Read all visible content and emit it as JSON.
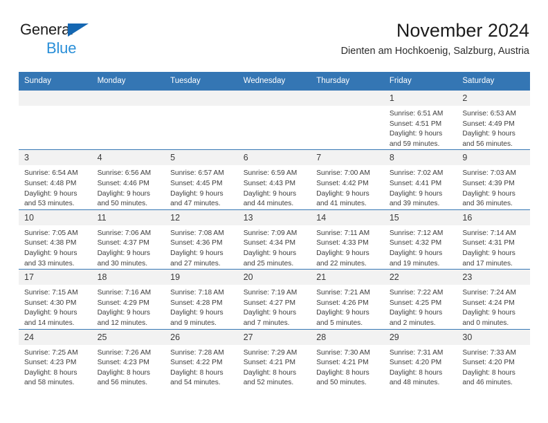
{
  "brand": {
    "name_part1": "General",
    "name_part2": "Blue",
    "triangle_color": "#1567b2",
    "blue_text_color": "#2a8fd8"
  },
  "header": {
    "title": "November 2024",
    "subtitle": "Dienten am Hochkoenig, Salzburg, Austria"
  },
  "theme": {
    "header_blue": "#3476b4",
    "daynum_band": "#f2f2f2",
    "text": "#3c3c3c"
  },
  "calendar": {
    "weekday_headers": [
      "Sunday",
      "Monday",
      "Tuesday",
      "Wednesday",
      "Thursday",
      "Friday",
      "Saturday"
    ],
    "weeks": [
      [
        {
          "day": "",
          "lines": []
        },
        {
          "day": "",
          "lines": []
        },
        {
          "day": "",
          "lines": []
        },
        {
          "day": "",
          "lines": []
        },
        {
          "day": "",
          "lines": []
        },
        {
          "day": "1",
          "lines": [
            "Sunrise: 6:51 AM",
            "Sunset: 4:51 PM",
            "Daylight: 9 hours",
            "and 59 minutes."
          ]
        },
        {
          "day": "2",
          "lines": [
            "Sunrise: 6:53 AM",
            "Sunset: 4:49 PM",
            "Daylight: 9 hours",
            "and 56 minutes."
          ]
        }
      ],
      [
        {
          "day": "3",
          "lines": [
            "Sunrise: 6:54 AM",
            "Sunset: 4:48 PM",
            "Daylight: 9 hours",
            "and 53 minutes."
          ]
        },
        {
          "day": "4",
          "lines": [
            "Sunrise: 6:56 AM",
            "Sunset: 4:46 PM",
            "Daylight: 9 hours",
            "and 50 minutes."
          ]
        },
        {
          "day": "5",
          "lines": [
            "Sunrise: 6:57 AM",
            "Sunset: 4:45 PM",
            "Daylight: 9 hours",
            "and 47 minutes."
          ]
        },
        {
          "day": "6",
          "lines": [
            "Sunrise: 6:59 AM",
            "Sunset: 4:43 PM",
            "Daylight: 9 hours",
            "and 44 minutes."
          ]
        },
        {
          "day": "7",
          "lines": [
            "Sunrise: 7:00 AM",
            "Sunset: 4:42 PM",
            "Daylight: 9 hours",
            "and 41 minutes."
          ]
        },
        {
          "day": "8",
          "lines": [
            "Sunrise: 7:02 AM",
            "Sunset: 4:41 PM",
            "Daylight: 9 hours",
            "and 39 minutes."
          ]
        },
        {
          "day": "9",
          "lines": [
            "Sunrise: 7:03 AM",
            "Sunset: 4:39 PM",
            "Daylight: 9 hours",
            "and 36 minutes."
          ]
        }
      ],
      [
        {
          "day": "10",
          "lines": [
            "Sunrise: 7:05 AM",
            "Sunset: 4:38 PM",
            "Daylight: 9 hours",
            "and 33 minutes."
          ]
        },
        {
          "day": "11",
          "lines": [
            "Sunrise: 7:06 AM",
            "Sunset: 4:37 PM",
            "Daylight: 9 hours",
            "and 30 minutes."
          ]
        },
        {
          "day": "12",
          "lines": [
            "Sunrise: 7:08 AM",
            "Sunset: 4:36 PM",
            "Daylight: 9 hours",
            "and 27 minutes."
          ]
        },
        {
          "day": "13",
          "lines": [
            "Sunrise: 7:09 AM",
            "Sunset: 4:34 PM",
            "Daylight: 9 hours",
            "and 25 minutes."
          ]
        },
        {
          "day": "14",
          "lines": [
            "Sunrise: 7:11 AM",
            "Sunset: 4:33 PM",
            "Daylight: 9 hours",
            "and 22 minutes."
          ]
        },
        {
          "day": "15",
          "lines": [
            "Sunrise: 7:12 AM",
            "Sunset: 4:32 PM",
            "Daylight: 9 hours",
            "and 19 minutes."
          ]
        },
        {
          "day": "16",
          "lines": [
            "Sunrise: 7:14 AM",
            "Sunset: 4:31 PM",
            "Daylight: 9 hours",
            "and 17 minutes."
          ]
        }
      ],
      [
        {
          "day": "17",
          "lines": [
            "Sunrise: 7:15 AM",
            "Sunset: 4:30 PM",
            "Daylight: 9 hours",
            "and 14 minutes."
          ]
        },
        {
          "day": "18",
          "lines": [
            "Sunrise: 7:16 AM",
            "Sunset: 4:29 PM",
            "Daylight: 9 hours",
            "and 12 minutes."
          ]
        },
        {
          "day": "19",
          "lines": [
            "Sunrise: 7:18 AM",
            "Sunset: 4:28 PM",
            "Daylight: 9 hours",
            "and 9 minutes."
          ]
        },
        {
          "day": "20",
          "lines": [
            "Sunrise: 7:19 AM",
            "Sunset: 4:27 PM",
            "Daylight: 9 hours",
            "and 7 minutes."
          ]
        },
        {
          "day": "21",
          "lines": [
            "Sunrise: 7:21 AM",
            "Sunset: 4:26 PM",
            "Daylight: 9 hours",
            "and 5 minutes."
          ]
        },
        {
          "day": "22",
          "lines": [
            "Sunrise: 7:22 AM",
            "Sunset: 4:25 PM",
            "Daylight: 9 hours",
            "and 2 minutes."
          ]
        },
        {
          "day": "23",
          "lines": [
            "Sunrise: 7:24 AM",
            "Sunset: 4:24 PM",
            "Daylight: 9 hours",
            "and 0 minutes."
          ]
        }
      ],
      [
        {
          "day": "24",
          "lines": [
            "Sunrise: 7:25 AM",
            "Sunset: 4:23 PM",
            "Daylight: 8 hours",
            "and 58 minutes."
          ]
        },
        {
          "day": "25",
          "lines": [
            "Sunrise: 7:26 AM",
            "Sunset: 4:23 PM",
            "Daylight: 8 hours",
            "and 56 minutes."
          ]
        },
        {
          "day": "26",
          "lines": [
            "Sunrise: 7:28 AM",
            "Sunset: 4:22 PM",
            "Daylight: 8 hours",
            "and 54 minutes."
          ]
        },
        {
          "day": "27",
          "lines": [
            "Sunrise: 7:29 AM",
            "Sunset: 4:21 PM",
            "Daylight: 8 hours",
            "and 52 minutes."
          ]
        },
        {
          "day": "28",
          "lines": [
            "Sunrise: 7:30 AM",
            "Sunset: 4:21 PM",
            "Daylight: 8 hours",
            "and 50 minutes."
          ]
        },
        {
          "day": "29",
          "lines": [
            "Sunrise: 7:31 AM",
            "Sunset: 4:20 PM",
            "Daylight: 8 hours",
            "and 48 minutes."
          ]
        },
        {
          "day": "30",
          "lines": [
            "Sunrise: 7:33 AM",
            "Sunset: 4:20 PM",
            "Daylight: 8 hours",
            "and 46 minutes."
          ]
        }
      ]
    ]
  }
}
